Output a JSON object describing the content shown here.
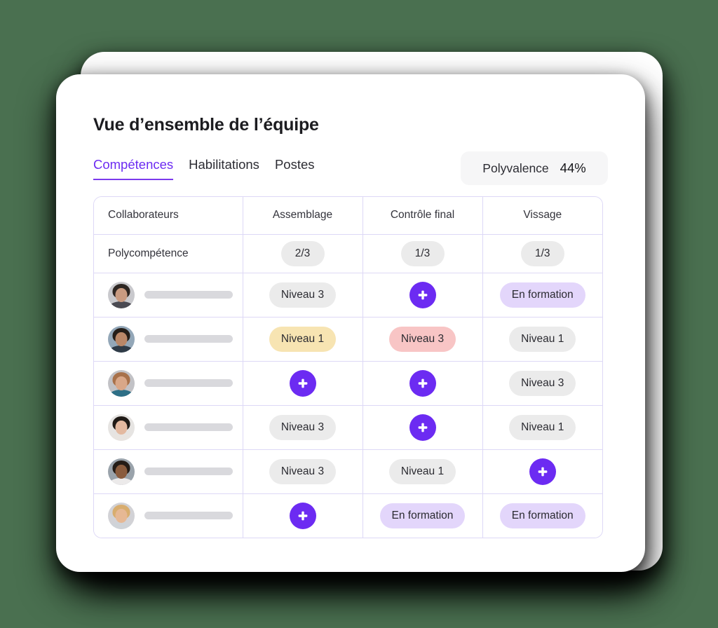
{
  "header": {
    "title": "Vue d’ensemble de l’équipe",
    "tabs": [
      {
        "label": "Compétences",
        "active": true
      },
      {
        "label": "Habilitations",
        "active": false
      },
      {
        "label": "Postes",
        "active": false
      }
    ],
    "polyvalence": {
      "label": "Polyvalence",
      "value": "44%"
    }
  },
  "table": {
    "columns": [
      "Collaborateurs",
      "Assemblage",
      "Contrôle final",
      "Vissage"
    ],
    "summary_row": {
      "label": "Polycompétence",
      "values": [
        "2/3",
        "1/3",
        "1/3"
      ]
    },
    "rows": [
      {
        "name": "",
        "cells": [
          {
            "type": "pill",
            "label": "Niveau 3",
            "variant": "gray"
          },
          {
            "type": "add",
            "label": "+"
          },
          {
            "type": "pill",
            "label": "En formation",
            "variant": "purple"
          }
        ]
      },
      {
        "name": "",
        "cells": [
          {
            "type": "pill",
            "label": "Niveau 1",
            "variant": "yellow"
          },
          {
            "type": "pill",
            "label": "Niveau 3",
            "variant": "red"
          },
          {
            "type": "pill",
            "label": "Niveau 1",
            "variant": "gray"
          }
        ]
      },
      {
        "name": "",
        "cells": [
          {
            "type": "add",
            "label": "+"
          },
          {
            "type": "add",
            "label": "+"
          },
          {
            "type": "pill",
            "label": "Niveau 3",
            "variant": "gray"
          }
        ]
      },
      {
        "name": "",
        "cells": [
          {
            "type": "pill",
            "label": "Niveau 3",
            "variant": "gray"
          },
          {
            "type": "add",
            "label": "+"
          },
          {
            "type": "pill",
            "label": "Niveau 1",
            "variant": "gray"
          }
        ]
      },
      {
        "name": "",
        "cells": [
          {
            "type": "pill",
            "label": "Niveau 3",
            "variant": "gray"
          },
          {
            "type": "pill",
            "label": "Niveau 1",
            "variant": "gray"
          },
          {
            "type": "add",
            "label": "+"
          }
        ]
      },
      {
        "name": "",
        "cells": [
          {
            "type": "add",
            "label": "+"
          },
          {
            "type": "pill",
            "label": "En formation",
            "variant": "purple"
          },
          {
            "type": "pill",
            "label": "En formation",
            "variant": "purple"
          }
        ]
      }
    ],
    "avatars": [
      {
        "hair": "#2d2622",
        "face": "#c99b81",
        "body": "#4a4a52",
        "bg": "#c9c9cd"
      },
      {
        "hair": "#241d18",
        "face": "#b98768",
        "body": "#2f3b47",
        "bg": "#93a7b8"
      },
      {
        "hair": "#a8714a",
        "face": "#d9a788",
        "body": "#2e6f86",
        "bg": "#c2c2c6"
      },
      {
        "hair": "#1f1a16",
        "face": "#e3b9a0",
        "body": "#e8e4e0",
        "bg": "#e6e4e2"
      },
      {
        "hair": "#241c16",
        "face": "#8a5c3e",
        "body": "#eceaea",
        "bg": "#9aa3ab"
      },
      {
        "hair": "#d8ad6e",
        "face": "#e6b894",
        "body": "#cfd3d8",
        "bg": "#d2d2d6"
      }
    ]
  },
  "colors": {
    "background": "#4a7050",
    "accent": "#6c2bf2",
    "tab_active": "#6c2bf2",
    "border": "#ddd8f6",
    "pill_gray": "#ebebeb",
    "pill_yellow": "#f7e4b2",
    "pill_red": "#f8c5c5",
    "pill_purple": "#e3d6fb"
  },
  "icons": {
    "add": "plus-icon"
  }
}
